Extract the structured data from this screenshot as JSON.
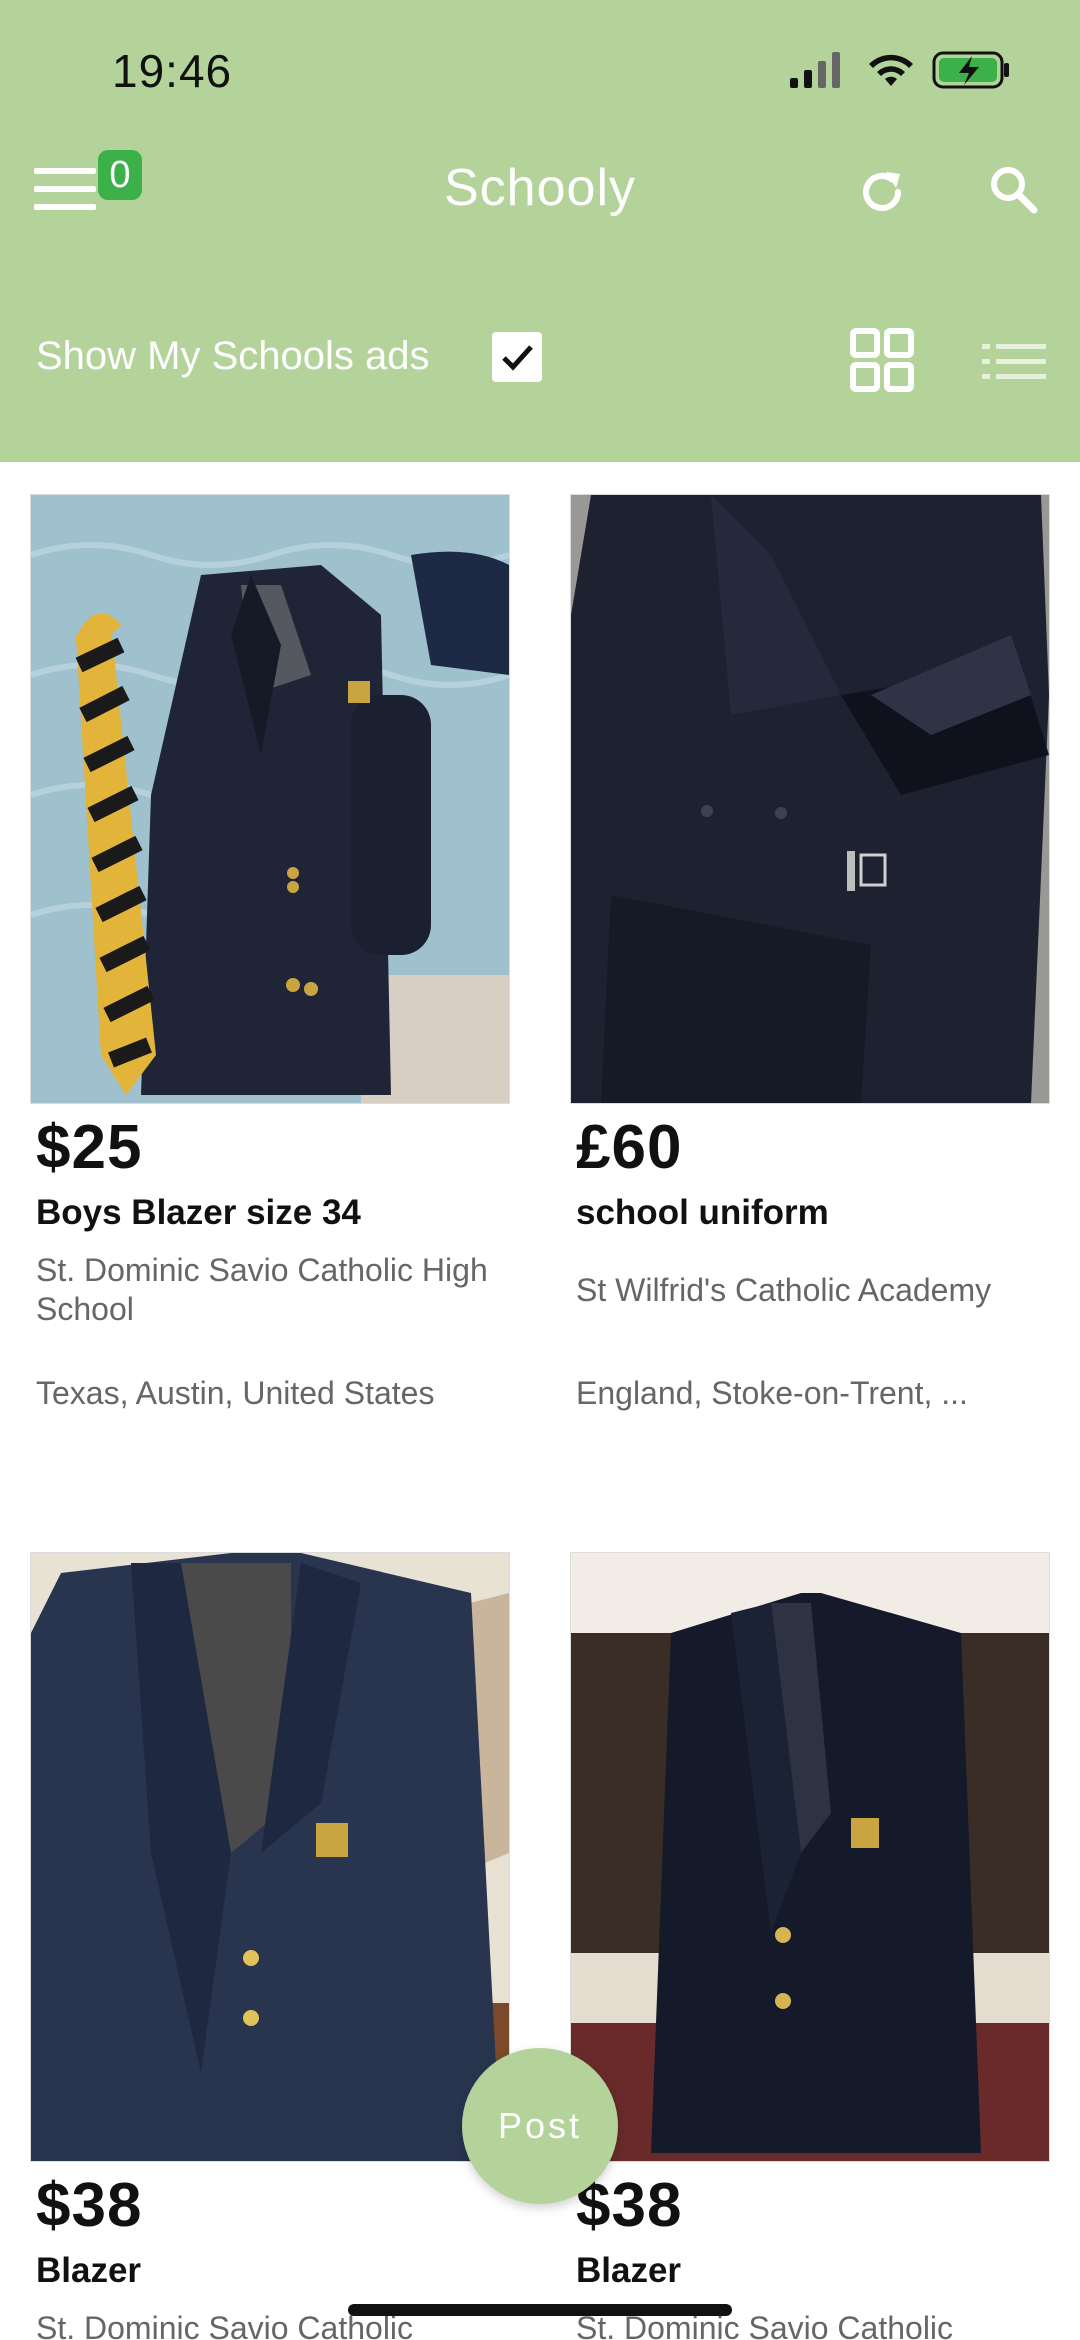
{
  "status_bar": {
    "time": "19:46"
  },
  "header": {
    "menu_badge_count": "0",
    "title": "Schooly",
    "icons": [
      "menu-icon",
      "refresh-icon",
      "search-icon"
    ]
  },
  "filter": {
    "label": "Show My Schools ads",
    "checked": true,
    "view_modes": [
      "grid-view-icon",
      "list-view-icon"
    ],
    "active_view": "grid"
  },
  "listings": [
    {
      "price": "$25",
      "title": "Boys Blazer size 34",
      "school": "St. Dominic Savio Catholic High School",
      "location": "Texas, Austin, United States"
    },
    {
      "price": "£60",
      "title": "school uniform",
      "school": "St Wilfrid's Catholic Academy",
      "location": "England, Stoke-on-Trent, ..."
    },
    {
      "price": "$38",
      "title": "Blazer",
      "school": "St. Dominic Savio Catholic",
      "location": ""
    },
    {
      "price": "$38",
      "title": "Blazer",
      "school": "St. Dominic Savio Catholic",
      "location": ""
    }
  ],
  "post_button": {
    "label": "Post"
  },
  "colors": {
    "header_bg": "#b3d39a",
    "badge": "#3cb14a",
    "text_secondary": "#666666"
  }
}
